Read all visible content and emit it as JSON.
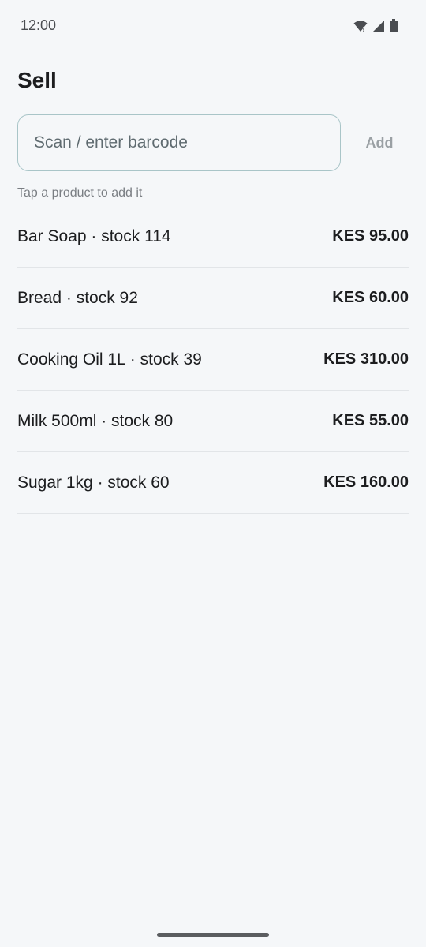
{
  "status_bar": {
    "time": "12:00",
    "icons": [
      "wifi-icon",
      "cellular-signal-icon",
      "battery-icon"
    ]
  },
  "page": {
    "title": "Sell"
  },
  "barcode": {
    "placeholder": "Scan / enter barcode",
    "value": "",
    "add_label": "Add"
  },
  "hint": "Tap a product to add it",
  "products": [
    {
      "name": "Bar Soap · stock 114",
      "price": "KES 95.00"
    },
    {
      "name": "Bread · stock 92",
      "price": "KES 60.00"
    },
    {
      "name": "Cooking Oil 1L · stock 39",
      "price": "KES 310.00"
    },
    {
      "name": "Milk 500ml · stock 80",
      "price": "KES 55.00"
    },
    {
      "name": "Sugar 1kg · stock 60",
      "price": "KES 160.00"
    }
  ],
  "colors": {
    "background": "#f5f7f9",
    "input_border": "#a9c5c8",
    "text_primary": "#1c1d1f",
    "text_muted": "#7a7e83",
    "add_disabled": "#9aa0a4"
  }
}
